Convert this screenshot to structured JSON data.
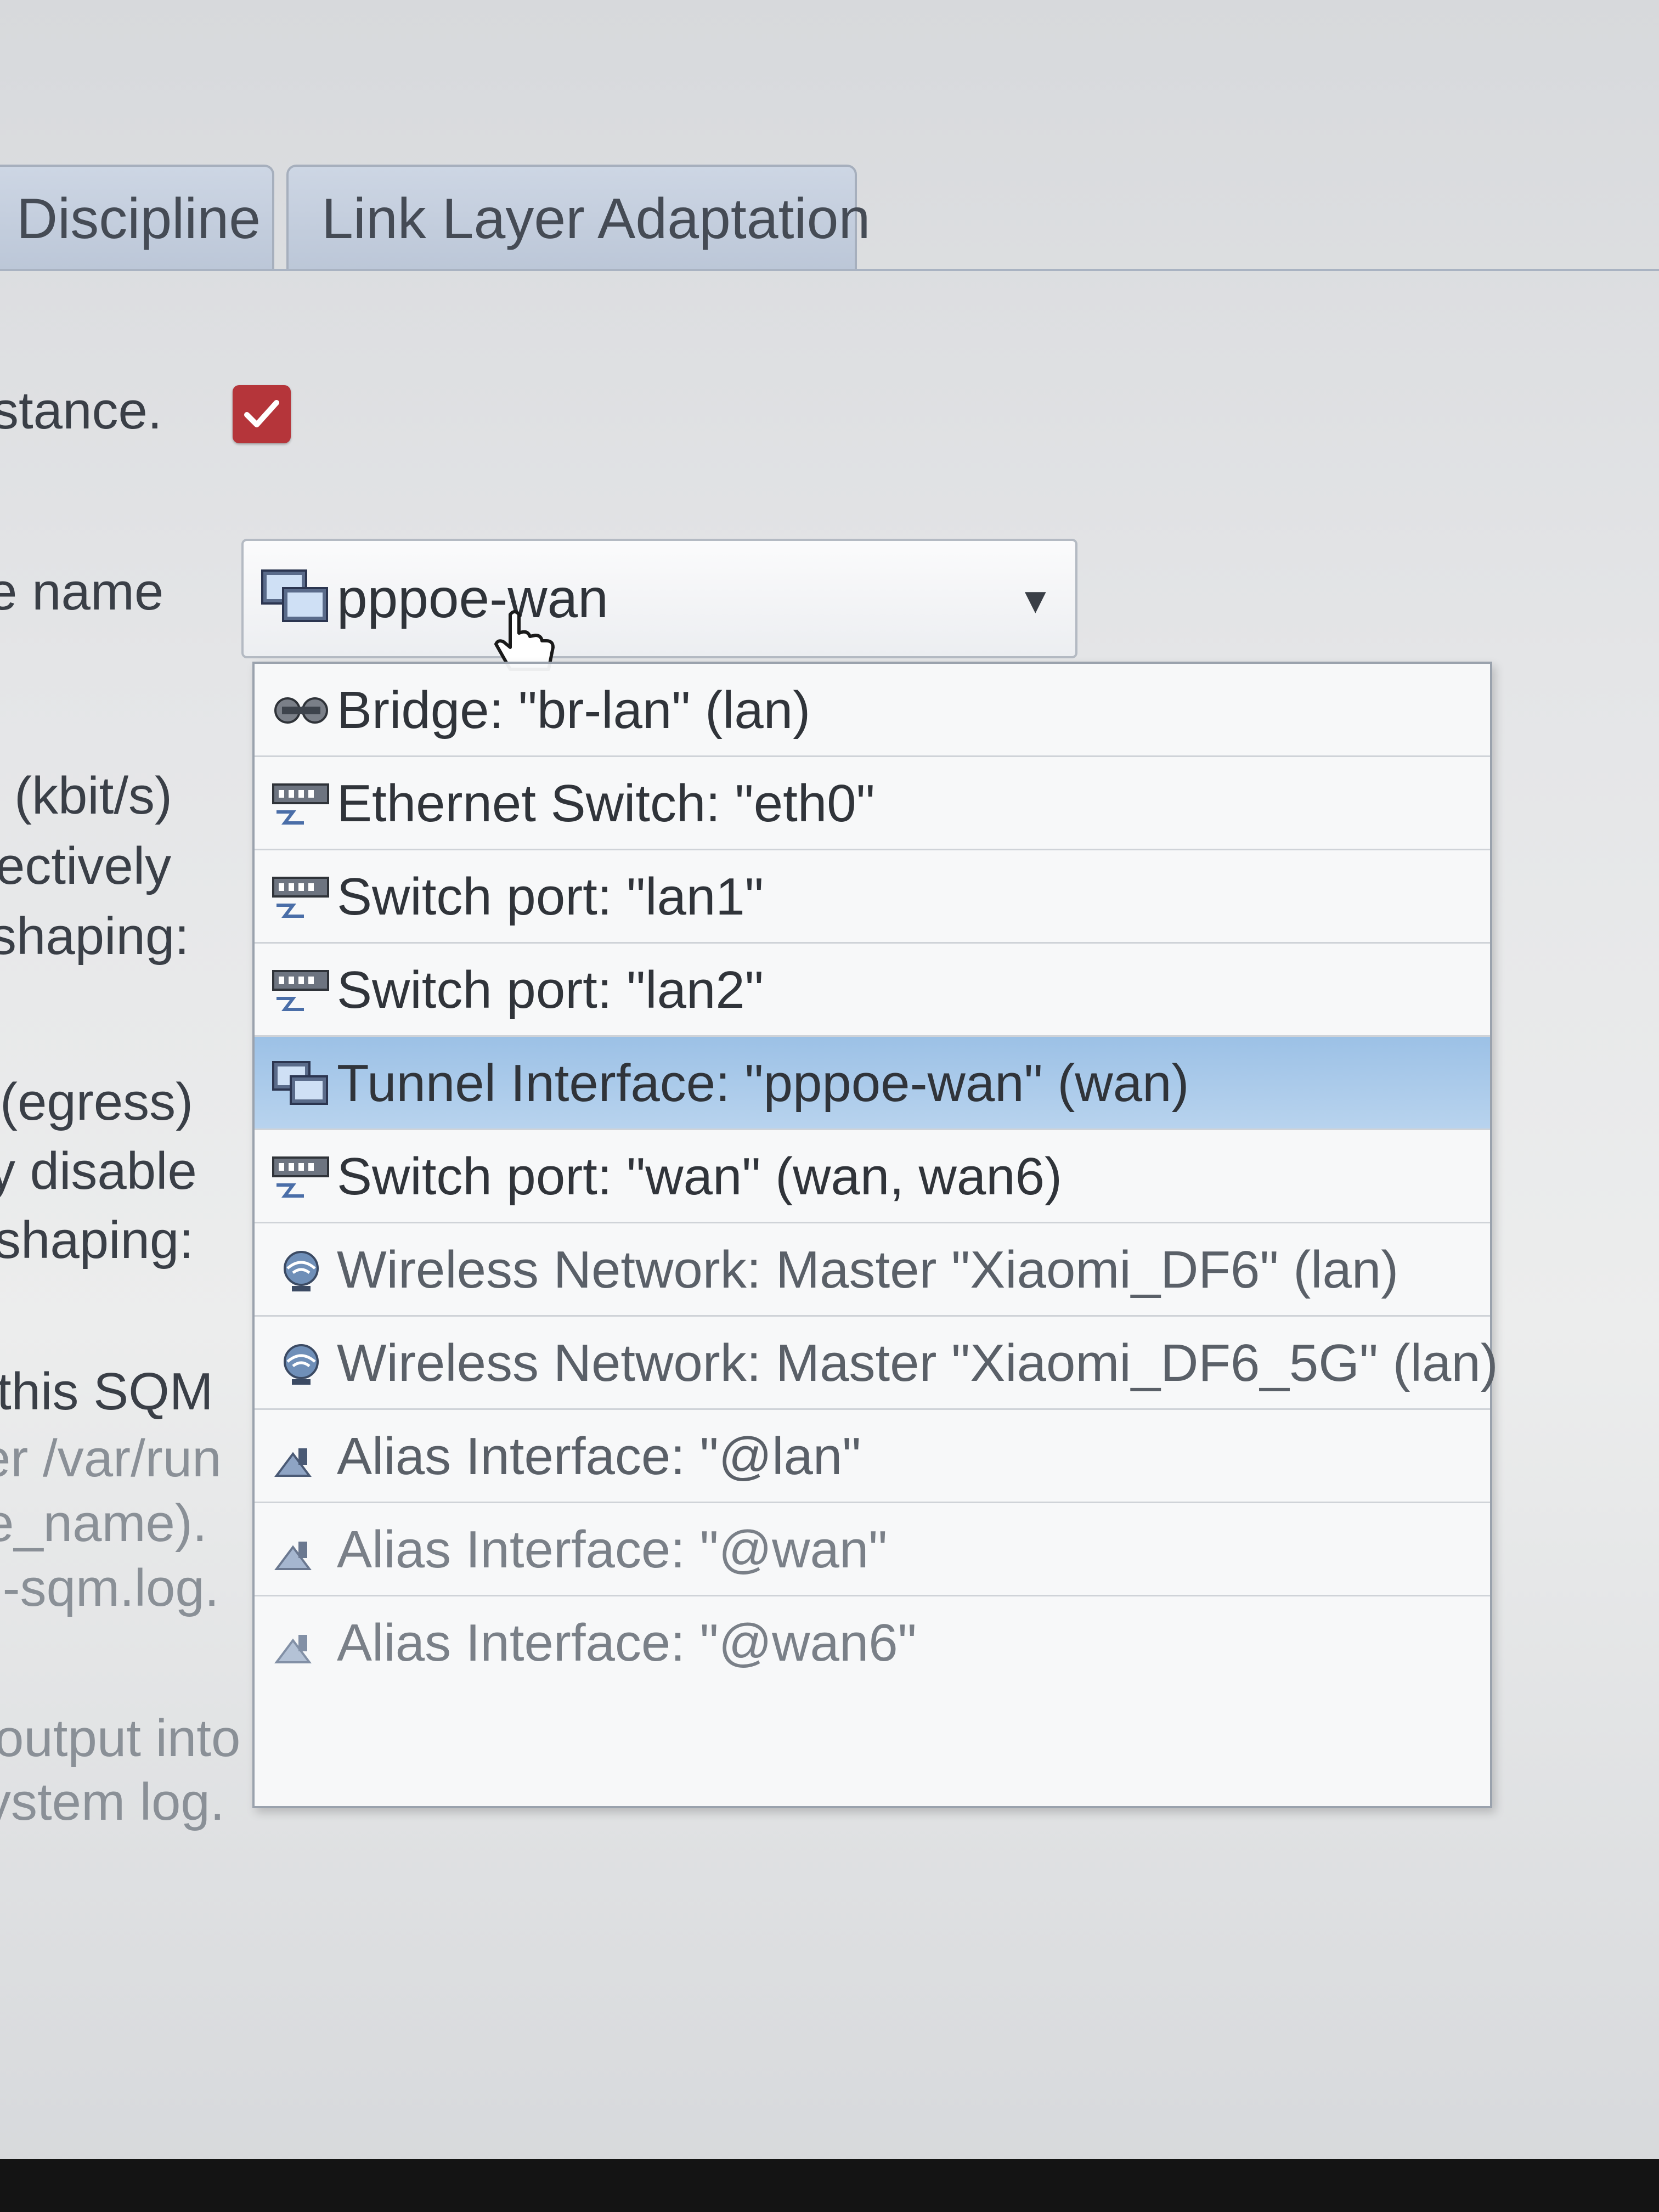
{
  "tabs": [
    {
      "label": "Discipline"
    },
    {
      "label": "Link Layer Adaptation"
    }
  ],
  "left_labels": [
    "stance.",
    "e name",
    "(kbit/s)",
    "ectively",
    "shaping:",
    "(egress)",
    "y disable",
    "shaping:",
    "this SQM",
    "er /var/run",
    "e_name).",
    "]-sqm.log.",
    "output into",
    "ystem log."
  ],
  "checkbox": {
    "checked": true,
    "color": "#b5353a"
  },
  "interface_select": {
    "value": "pppoe-wan",
    "icon": "tunnel-interface-icon",
    "arrow": "▼"
  },
  "dropdown_options": [
    {
      "label": "Bridge: \"br-lan\" (lan)",
      "icon": "bridge-icon"
    },
    {
      "label": "Ethernet Switch: \"eth0\"",
      "icon": "switch-icon"
    },
    {
      "label": "Switch port: \"lan1\"",
      "icon": "switch-port-icon"
    },
    {
      "label": "Switch port: \"lan2\"",
      "icon": "switch-port-icon"
    },
    {
      "label": "Tunnel Interface: \"pppoe-wan\" (wan)",
      "icon": "tunnel-interface-icon",
      "selected": true
    },
    {
      "label": "Switch port: \"wan\" (wan, wan6)",
      "icon": "switch-port-icon"
    },
    {
      "label": "Wireless Network: Master \"Xiaomi_DF6\" (lan)",
      "icon": "wireless-icon"
    },
    {
      "label": "Wireless Network: Master \"Xiaomi_DF6_5G\" (lan)",
      "icon": "wireless-icon"
    },
    {
      "label": "Alias Interface: \"@lan\"",
      "icon": "alias-icon"
    },
    {
      "label": "Alias Interface: \"@wan\"",
      "icon": "alias-icon"
    },
    {
      "label": "Alias Interface: \"@wan6\"",
      "icon": "alias-icon"
    }
  ],
  "colors": {
    "selected_highlight": "#a9cbeb",
    "tab_background": "#c3cddd",
    "checkbox": "#b5353a"
  }
}
